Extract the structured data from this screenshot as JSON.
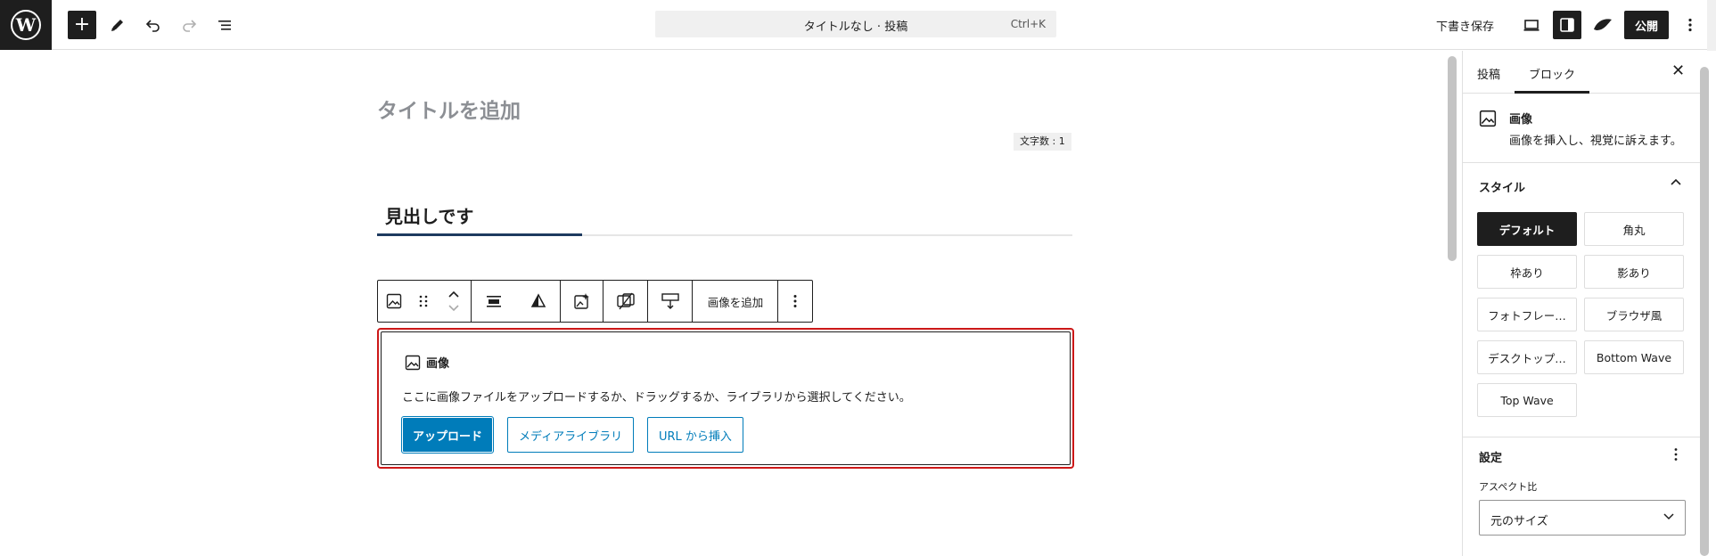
{
  "header": {
    "logo_letter": "W",
    "command_bar": {
      "title": "タイトルなし · 投稿",
      "shortcut": "Ctrl+K"
    },
    "save_draft": "下書き保存",
    "publish": "公開"
  },
  "editor": {
    "title_placeholder": "タイトルを追加",
    "char_count": "文字数 : 1",
    "heading": "見出しです",
    "toolbar": {
      "add_image_label": "画像を追加"
    },
    "image_block": {
      "label": "画像",
      "instructions": "ここに画像ファイルをアップロードするか、ドラッグするか、ライブラリから選択してください。",
      "upload": "アップロード",
      "media_library": "メディアライブラリ",
      "insert_url": "URL から挿入"
    }
  },
  "sidebar": {
    "tabs": [
      "投稿",
      "ブロック"
    ],
    "block_card": {
      "title": "画像",
      "description": "画像を挿入し、視覚に訴えます。"
    },
    "styles_title": "スタイル",
    "styles": [
      "デフォルト",
      "角丸",
      "枠あり",
      "影あり",
      "フォトフレー…",
      "ブラウザ風",
      "デスクトップ…",
      "Bottom Wave",
      "Top Wave"
    ],
    "settings_title": "設定",
    "aspect_label": "アスペクト比",
    "aspect_value": "元のサイズ"
  },
  "colors": {
    "accent": "#007cba",
    "dark": "#1e1e1e",
    "selection_outline": "#cc1818"
  }
}
